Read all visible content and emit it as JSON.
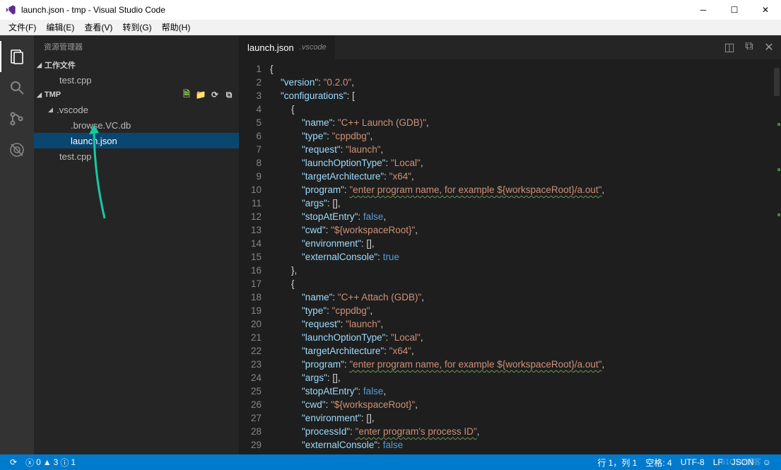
{
  "window": {
    "title": "launch.json - tmp - Visual Studio Code"
  },
  "menu": {
    "items": [
      "文件(F)",
      "编辑(E)",
      "查看(V)",
      "转到(G)",
      "帮助(H)"
    ]
  },
  "sidebar": {
    "title": "资源管理器",
    "sections": {
      "workfiles": {
        "label": "工作文件",
        "items": [
          "test.cpp"
        ]
      },
      "folder": {
        "label": "TMP",
        "tree": [
          {
            "label": ".vscode",
            "isFolder": true,
            "children": [
              ".browse.VC.db",
              "launch.json"
            ]
          },
          {
            "label": "test.cpp",
            "isFolder": false
          }
        ]
      }
    },
    "activeFile": "launch.json"
  },
  "tab": {
    "name": "launch.json",
    "path": ".vscode"
  },
  "code": {
    "lines": [
      [
        [
          "p",
          "{"
        ]
      ],
      [
        [
          "p",
          "    "
        ],
        [
          "k",
          "\"version\""
        ],
        [
          "p",
          ": "
        ],
        [
          "s",
          "\"0.2.0\""
        ],
        [
          "p",
          ","
        ]
      ],
      [
        [
          "p",
          "    "
        ],
        [
          "k",
          "\"configurations\""
        ],
        [
          "p",
          ": ["
        ]
      ],
      [
        [
          "p",
          "        {"
        ]
      ],
      [
        [
          "p",
          "            "
        ],
        [
          "k",
          "\"name\""
        ],
        [
          "p",
          ": "
        ],
        [
          "s",
          "\"C++ Launch (GDB)\""
        ],
        [
          "p",
          ","
        ]
      ],
      [
        [
          "p",
          "            "
        ],
        [
          "k",
          "\"type\""
        ],
        [
          "p",
          ": "
        ],
        [
          "s",
          "\"cppdbg\""
        ],
        [
          "p",
          ","
        ]
      ],
      [
        [
          "p",
          "            "
        ],
        [
          "k",
          "\"request\""
        ],
        [
          "p",
          ": "
        ],
        [
          "s",
          "\"launch\""
        ],
        [
          "p",
          ","
        ]
      ],
      [
        [
          "p",
          "            "
        ],
        [
          "k",
          "\"launchOptionType\""
        ],
        [
          "p",
          ": "
        ],
        [
          "s",
          "\"Local\""
        ],
        [
          "p",
          ","
        ]
      ],
      [
        [
          "p",
          "            "
        ],
        [
          "k",
          "\"targetArchitecture\""
        ],
        [
          "p",
          ": "
        ],
        [
          "s",
          "\"x64\""
        ],
        [
          "p",
          ","
        ]
      ],
      [
        [
          "p",
          "            "
        ],
        [
          "k",
          "\"program\""
        ],
        [
          "p",
          ": "
        ],
        [
          "sw",
          "\"enter program name, for example ${workspaceRoot}/a.out\""
        ],
        [
          "p",
          ","
        ]
      ],
      [
        [
          "p",
          "            "
        ],
        [
          "k",
          "\"args\""
        ],
        [
          "p",
          ": [],"
        ]
      ],
      [
        [
          "p",
          "            "
        ],
        [
          "k",
          "\"stopAtEntry\""
        ],
        [
          "p",
          ": "
        ],
        [
          "b",
          "false"
        ],
        [
          "p",
          ","
        ]
      ],
      [
        [
          "p",
          "            "
        ],
        [
          "k",
          "\"cwd\""
        ],
        [
          "p",
          ": "
        ],
        [
          "s",
          "\"${workspaceRoot}\""
        ],
        [
          "p",
          ","
        ]
      ],
      [
        [
          "p",
          "            "
        ],
        [
          "k",
          "\"environment\""
        ],
        [
          "p",
          ": [],"
        ]
      ],
      [
        [
          "p",
          "            "
        ],
        [
          "k",
          "\"externalConsole\""
        ],
        [
          "p",
          ": "
        ],
        [
          "b",
          "true"
        ]
      ],
      [
        [
          "p",
          "        },"
        ]
      ],
      [
        [
          "p",
          "        {"
        ]
      ],
      [
        [
          "p",
          "            "
        ],
        [
          "k",
          "\"name\""
        ],
        [
          "p",
          ": "
        ],
        [
          "s",
          "\"C++ Attach (GDB)\""
        ],
        [
          "p",
          ","
        ]
      ],
      [
        [
          "p",
          "            "
        ],
        [
          "k",
          "\"type\""
        ],
        [
          "p",
          ": "
        ],
        [
          "s",
          "\"cppdbg\""
        ],
        [
          "p",
          ","
        ]
      ],
      [
        [
          "p",
          "            "
        ],
        [
          "k",
          "\"request\""
        ],
        [
          "p",
          ": "
        ],
        [
          "s",
          "\"launch\""
        ],
        [
          "p",
          ","
        ]
      ],
      [
        [
          "p",
          "            "
        ],
        [
          "k",
          "\"launchOptionType\""
        ],
        [
          "p",
          ": "
        ],
        [
          "s",
          "\"Local\""
        ],
        [
          "p",
          ","
        ]
      ],
      [
        [
          "p",
          "            "
        ],
        [
          "k",
          "\"targetArchitecture\""
        ],
        [
          "p",
          ": "
        ],
        [
          "s",
          "\"x64\""
        ],
        [
          "p",
          ","
        ]
      ],
      [
        [
          "p",
          "            "
        ],
        [
          "k",
          "\"program\""
        ],
        [
          "p",
          ": "
        ],
        [
          "sw",
          "\"enter program name, for example ${workspaceRoot}/a.out\""
        ],
        [
          "p",
          ","
        ]
      ],
      [
        [
          "p",
          "            "
        ],
        [
          "k",
          "\"args\""
        ],
        [
          "p",
          ": [],"
        ]
      ],
      [
        [
          "p",
          "            "
        ],
        [
          "k",
          "\"stopAtEntry\""
        ],
        [
          "p",
          ": "
        ],
        [
          "b",
          "false"
        ],
        [
          "p",
          ","
        ]
      ],
      [
        [
          "p",
          "            "
        ],
        [
          "k",
          "\"cwd\""
        ],
        [
          "p",
          ": "
        ],
        [
          "s",
          "\"${workspaceRoot}\""
        ],
        [
          "p",
          ","
        ]
      ],
      [
        [
          "p",
          "            "
        ],
        [
          "k",
          "\"environment\""
        ],
        [
          "p",
          ": [],"
        ]
      ],
      [
        [
          "p",
          "            "
        ],
        [
          "k",
          "\"processId\""
        ],
        [
          "p",
          ": "
        ],
        [
          "sw",
          "\"enter program's process ID\""
        ],
        [
          "p",
          ","
        ]
      ],
      [
        [
          "p",
          "            "
        ],
        [
          "k",
          "\"externalConsole\""
        ],
        [
          "p",
          ": "
        ],
        [
          "b",
          "false"
        ]
      ]
    ]
  },
  "status": {
    "errors": "0",
    "warnings": "3",
    "info": "1",
    "position": "行 1，列 1",
    "spaces": "空格: 4",
    "encoding": "UTF-8",
    "eol": "LF",
    "lang": "JSON",
    "smile": "☺"
  }
}
